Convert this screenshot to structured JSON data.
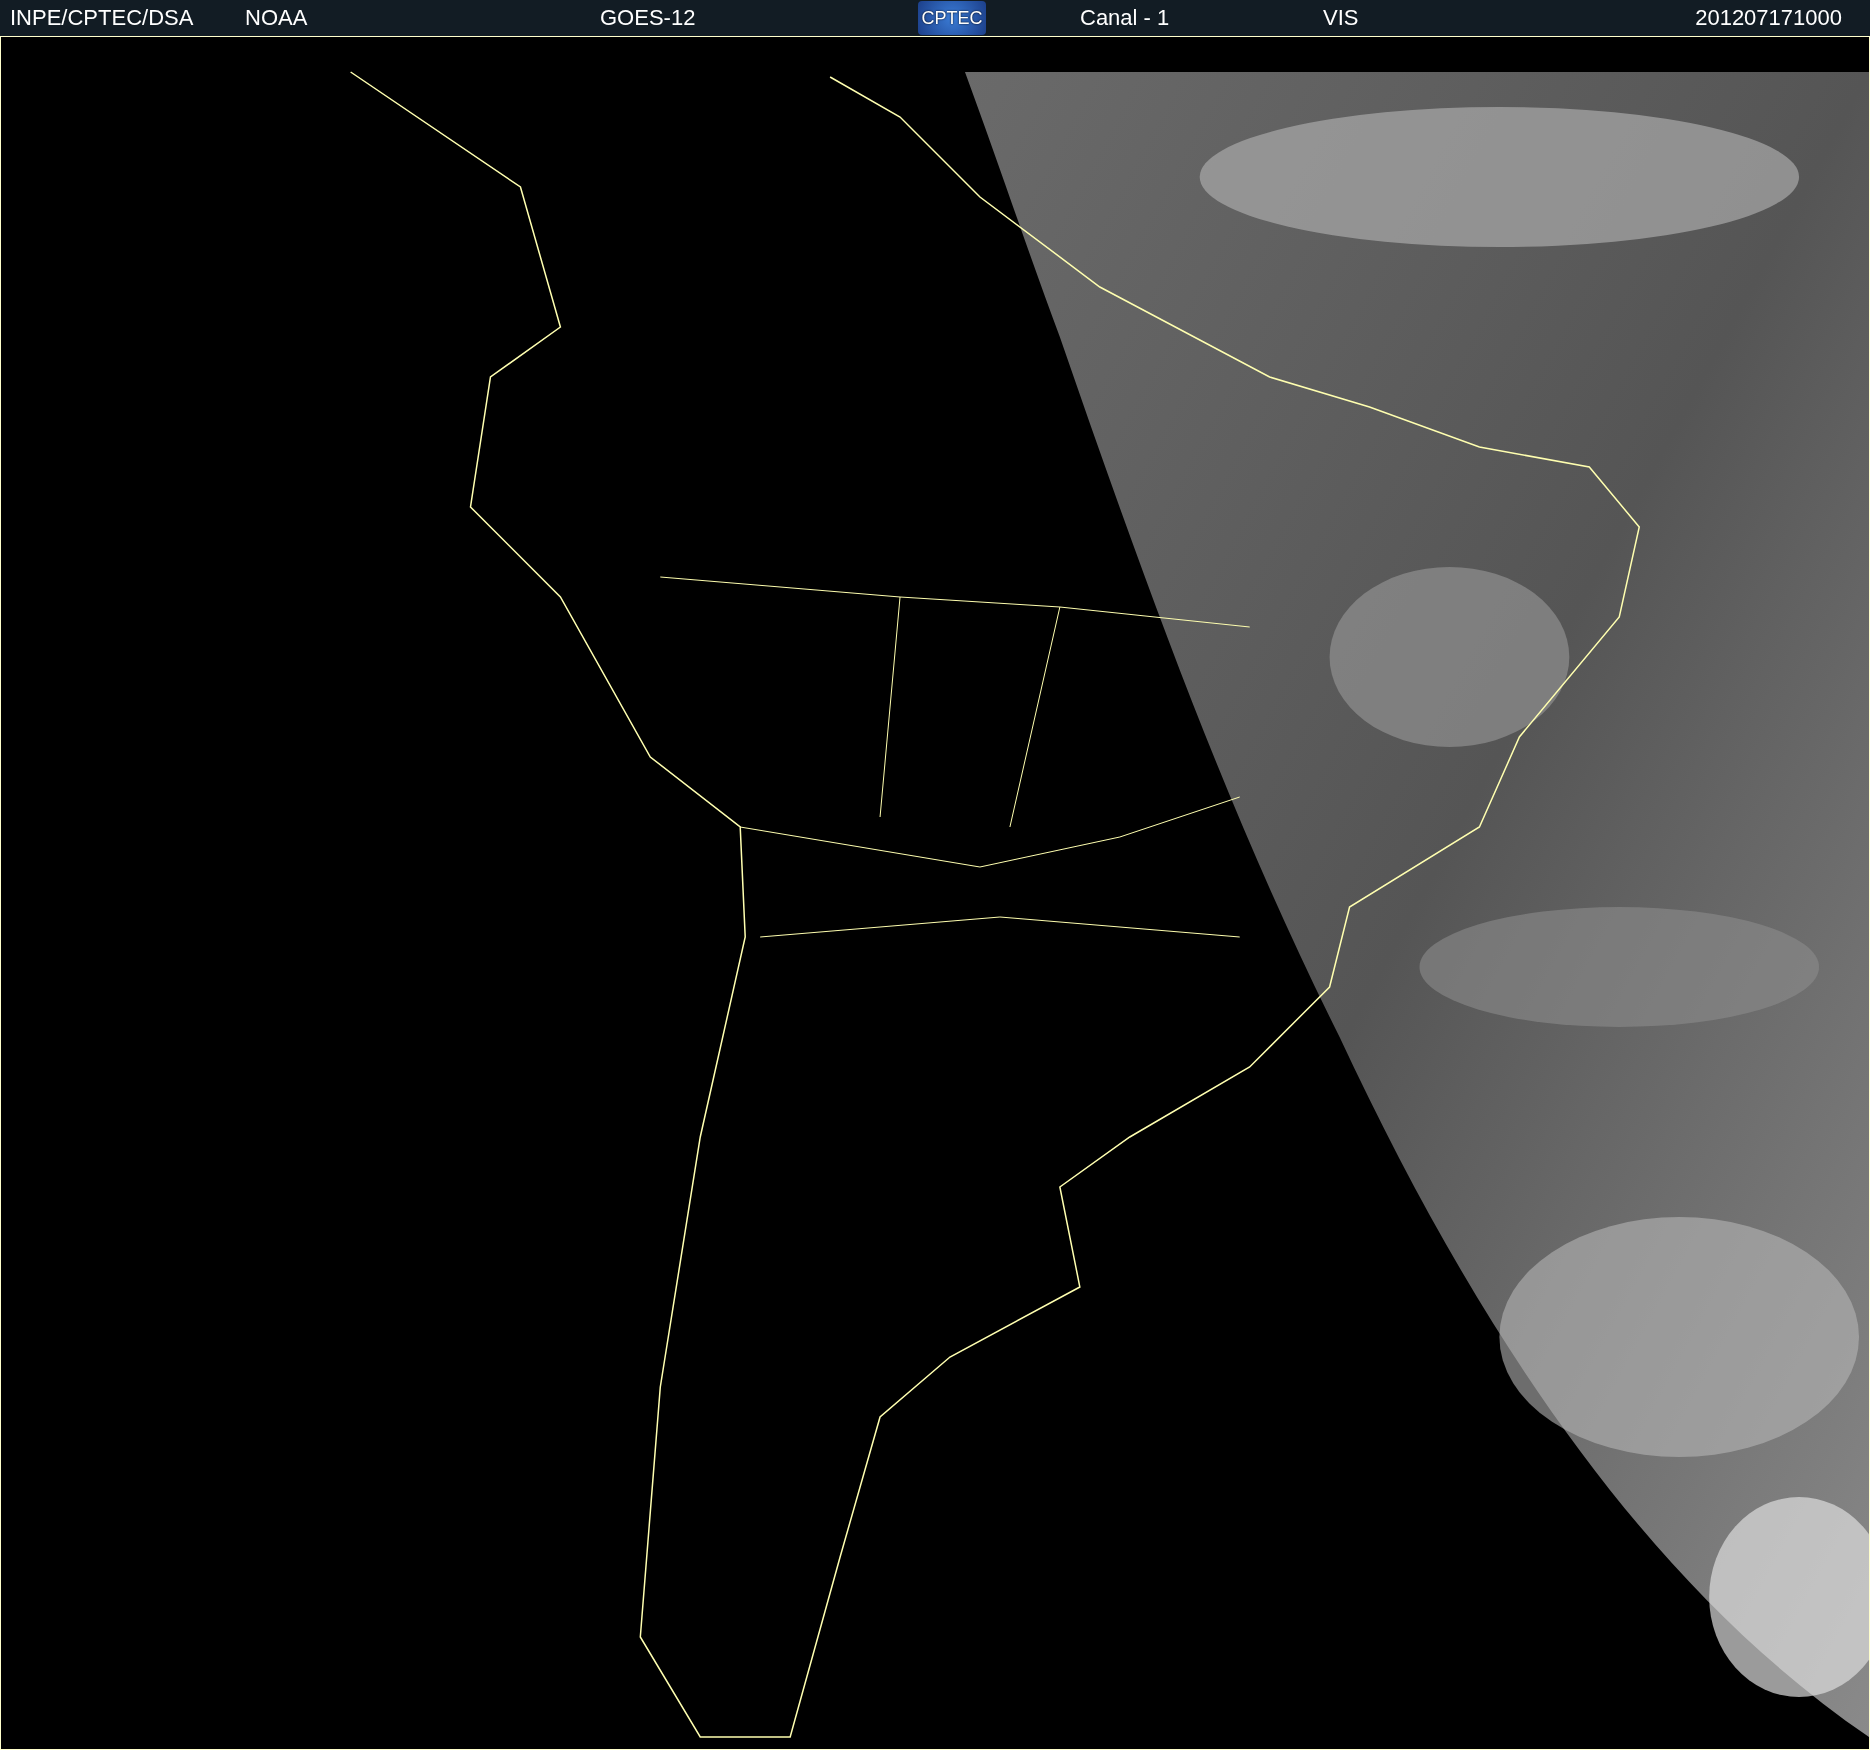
{
  "header": {
    "source": "INPE/CPTEC/DSA",
    "agency": "NOAA",
    "satellite": "GOES-12",
    "logo": "CPTEC",
    "channel": "Canal - 1",
    "band": "VIS",
    "timestamp": "201207171000"
  }
}
